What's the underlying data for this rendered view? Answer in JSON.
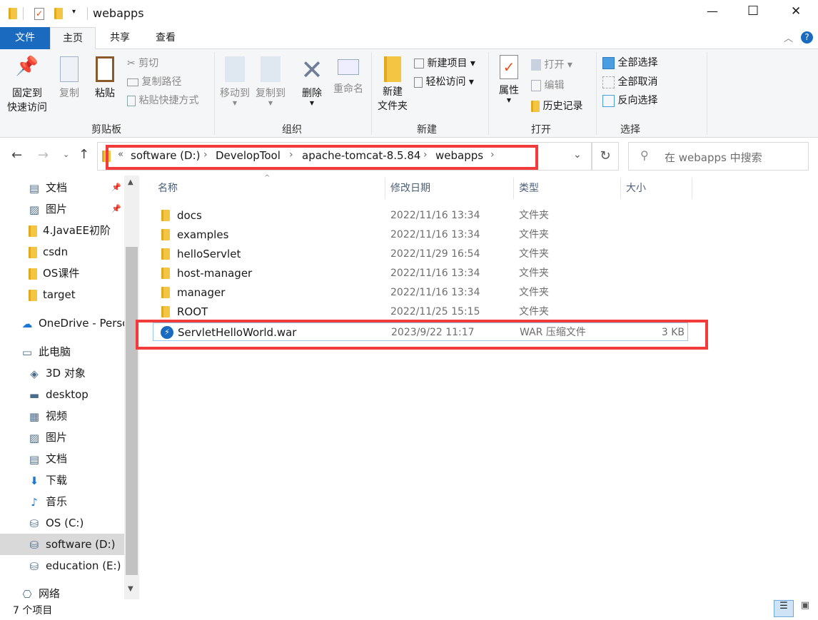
{
  "window": {
    "title": "webapps",
    "controls": {
      "minimize": "—",
      "maximize": "☐",
      "close": "✕"
    }
  },
  "tabs": [
    {
      "label": "文件"
    },
    {
      "label": "主页"
    },
    {
      "label": "共享"
    },
    {
      "label": "查看"
    }
  ],
  "ribbon": {
    "clipboard": {
      "label": "剪贴板",
      "pin": "固定到\n快速访问",
      "pin1": "固定到",
      "pin2": "快速访问",
      "copy": "复制",
      "paste": "粘贴",
      "cut": "剪切",
      "copy_path": "复制路径",
      "paste_shortcut": "粘贴快捷方式"
    },
    "organize": {
      "label": "组织",
      "move_to": "移动到",
      "copy_to": "复制到",
      "delete": "删除",
      "rename": "重命名"
    },
    "new": {
      "label": "新建",
      "new_folder1": "新建",
      "new_folder2": "文件夹",
      "new_item": "新建项目",
      "easy_access": "轻松访问"
    },
    "open": {
      "label": "打开",
      "properties": "属性",
      "open": "打开",
      "edit": "编辑",
      "history": "历史记录"
    },
    "select": {
      "label": "选择",
      "select_all": "全部选择",
      "select_none": "全部取消",
      "invert": "反向选择"
    }
  },
  "address": {
    "prefix": "«",
    "crumbs": [
      "software (D:)",
      "DevelopTool",
      "apache-tomcat-8.5.84",
      "webapps"
    ]
  },
  "search": {
    "placeholder": "在 webapps 中搜索"
  },
  "sidebar": {
    "items": [
      {
        "label": "文档",
        "icon": "document-icon",
        "pinned": true
      },
      {
        "label": "图片",
        "icon": "pictures-icon",
        "pinned": true
      },
      {
        "label": "4.JavaEE初阶",
        "icon": "folder-icon"
      },
      {
        "label": "csdn",
        "icon": "folder-icon"
      },
      {
        "label": "OS课件",
        "icon": "folder-icon"
      },
      {
        "label": "target",
        "icon": "folder-icon"
      },
      {
        "label": "OneDrive - Perso",
        "icon": "cloud-icon"
      },
      {
        "label": "此电脑",
        "icon": "computer-icon"
      },
      {
        "label": "3D 对象",
        "icon": "3d-objects-icon"
      },
      {
        "label": "desktop",
        "icon": "desktop-icon"
      },
      {
        "label": "视频",
        "icon": "video-icon"
      },
      {
        "label": "图片",
        "icon": "pictures-icon"
      },
      {
        "label": "文档",
        "icon": "document-icon"
      },
      {
        "label": "下载",
        "icon": "download-icon"
      },
      {
        "label": "音乐",
        "icon": "music-icon"
      },
      {
        "label": "OS (C:)",
        "icon": "drive-icon"
      },
      {
        "label": "software (D:)",
        "icon": "drive-icon",
        "selected": true
      },
      {
        "label": "education (E:)",
        "icon": "drive-icon"
      },
      {
        "label": "网络",
        "icon": "network-icon"
      }
    ]
  },
  "columns": [
    "名称",
    "修改日期",
    "类型",
    "大小"
  ],
  "files": [
    {
      "name": "docs",
      "date": "2022/11/16 13:34",
      "type": "文件夹",
      "size": ""
    },
    {
      "name": "examples",
      "date": "2022/11/16 13:34",
      "type": "文件夹",
      "size": ""
    },
    {
      "name": "helloServlet",
      "date": "2022/11/29 16:54",
      "type": "文件夹",
      "size": ""
    },
    {
      "name": "host-manager",
      "date": "2022/11/16 13:34",
      "type": "文件夹",
      "size": ""
    },
    {
      "name": "manager",
      "date": "2022/11/16 13:34",
      "type": "文件夹",
      "size": ""
    },
    {
      "name": "ROOT",
      "date": "2022/11/25 15:15",
      "type": "文件夹",
      "size": ""
    },
    {
      "name": "ServletHelloWorld.war",
      "date": "2023/9/22 11:17",
      "type": "WAR 压缩文件",
      "size": "3 KB"
    }
  ],
  "status": {
    "count": "7 个项目"
  },
  "colors": {
    "accent": "#1a6bbf",
    "highlight": "#f23b3b",
    "folder": "#f4c542"
  }
}
